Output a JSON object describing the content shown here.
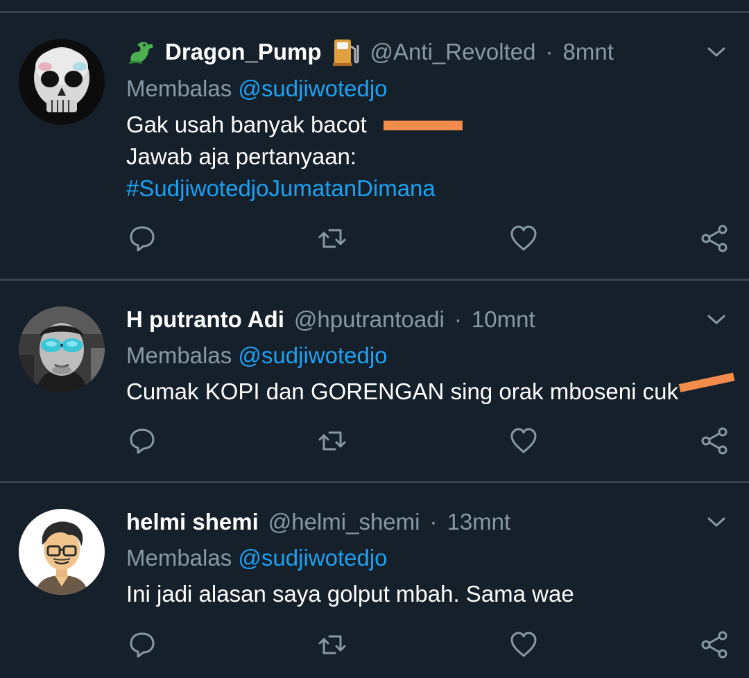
{
  "tweets": [
    {
      "display_name": "Dragon_Pump",
      "name_prefix_icon": "dragon-icon",
      "name_suffix_icon": "fuel-pump-icon",
      "handle": "@Anti_Revolted",
      "separator": "·",
      "time": "8mnt",
      "reply_prefix": "Membalas",
      "reply_to": "@sudjiwotedjo",
      "body_lines": [
        "Gak usah banyak bacot",
        "Jawab aja pertanyaan:"
      ],
      "hashtag": "#SudjiwotedjoJumatanDimana",
      "redaction_color": "#f28c4b"
    },
    {
      "display_name": "H putranto Adi",
      "handle": "@hputrantoadi",
      "separator": "·",
      "time": "10mnt",
      "reply_prefix": "Membalas",
      "reply_to": "@sudjiwotedjo",
      "body_lines": [
        "Cumak KOPI dan GORENGAN sing orak mboseni cuk"
      ],
      "redaction_color": "#f28c4b"
    },
    {
      "display_name": "helmi shemi",
      "handle": "@helmi_shemi",
      "separator": "·",
      "time": "13mnt",
      "reply_prefix": "Membalas",
      "reply_to": "@sudjiwotedjo",
      "body_lines": [
        "Ini jadi alasan saya golput mbah. Sama wae"
      ]
    }
  ],
  "action_icons": [
    "reply-icon",
    "retweet-icon",
    "like-icon",
    "share-icon"
  ],
  "colors": {
    "background": "#15202b",
    "divider": "#38444d",
    "text": "#ffffff",
    "muted": "#8899a6",
    "link": "#1da1f2"
  }
}
